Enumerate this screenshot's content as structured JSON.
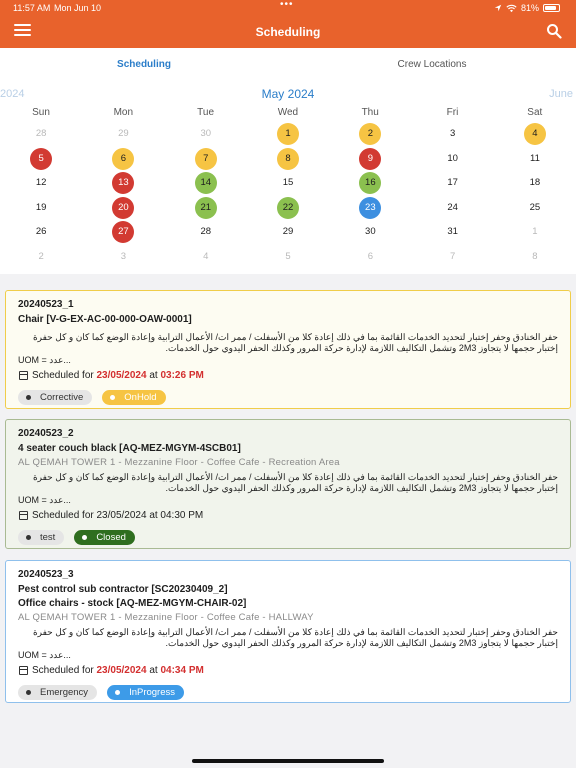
{
  "status_bar": {
    "time": "11:57 AM",
    "date": "Mon Jun 10",
    "dots": "•••",
    "battery_text": "81%",
    "battery_level": 0.81
  },
  "app_bar": {
    "title": "Scheduling"
  },
  "tabs": [
    {
      "label": "Scheduling",
      "active": true
    },
    {
      "label": "Crew Locations",
      "active": false
    }
  ],
  "calendar": {
    "prev_label": "2024",
    "month_label": "May 2024",
    "next_label": "June",
    "weekdays": [
      "Sun",
      "Mon",
      "Tue",
      "Wed",
      "Thu",
      "Fri",
      "Sat"
    ],
    "weeks": [
      [
        {
          "d": "28",
          "m": true
        },
        {
          "d": "29",
          "m": true
        },
        {
          "d": "30",
          "m": true
        },
        {
          "d": "1",
          "c": "yellow"
        },
        {
          "d": "2",
          "c": "yellow"
        },
        {
          "d": "3"
        },
        {
          "d": "4",
          "c": "yellow"
        }
      ],
      [
        {
          "d": "5",
          "c": "red"
        },
        {
          "d": "6",
          "c": "yellow"
        },
        {
          "d": "7",
          "c": "yellow"
        },
        {
          "d": "8",
          "c": "yellow"
        },
        {
          "d": "9",
          "c": "red"
        },
        {
          "d": "10"
        },
        {
          "d": "11"
        }
      ],
      [
        {
          "d": "12"
        },
        {
          "d": "13",
          "c": "red"
        },
        {
          "d": "14",
          "c": "green"
        },
        {
          "d": "15"
        },
        {
          "d": "16",
          "c": "green"
        },
        {
          "d": "17"
        },
        {
          "d": "18"
        }
      ],
      [
        {
          "d": "19"
        },
        {
          "d": "20",
          "c": "red"
        },
        {
          "d": "21",
          "c": "green"
        },
        {
          "d": "22",
          "c": "green"
        },
        {
          "d": "23",
          "c": "blue"
        },
        {
          "d": "24"
        },
        {
          "d": "25"
        }
      ],
      [
        {
          "d": "26"
        },
        {
          "d": "27",
          "c": "red"
        },
        {
          "d": "28"
        },
        {
          "d": "29"
        },
        {
          "d": "30"
        },
        {
          "d": "31"
        },
        {
          "d": "1",
          "m": true
        }
      ],
      [
        {
          "d": "2",
          "m": true
        },
        {
          "d": "3",
          "m": true
        },
        {
          "d": "4",
          "m": true
        },
        {
          "d": "5",
          "m": true
        },
        {
          "d": "6",
          "m": true
        },
        {
          "d": "7",
          "m": true
        },
        {
          "d": "8",
          "m": true
        }
      ]
    ]
  },
  "colors": {
    "brand": "#e8622c",
    "accent_blue": "#2a7dc9",
    "yellow": "#f6c443",
    "red": "#d23a32",
    "green": "#8bc04f",
    "blue": "#3d8fe0",
    "overdue_red": "#d32f2f"
  },
  "cards": [
    {
      "code": "20240523_1",
      "asset": "Chair [V-G-EX-AC-00-000-OAW-0001]",
      "description_line1": "حفر الخنادق وحفر إختبار لتحديد الخدمات القائمة بما في ذلك إعادة كلا من الأسفلت / ممر ات/ الأعمال الترابية وإعادة الوضع كما كان و كل حفرة",
      "description_line2": "إختبار حجمها لا يتجاوز 2M3 وتشمل التكاليف اللازمة لإدارة حركة المرور وكذلك  الحفر اليدوي حول الخدمات.",
      "uom": "UOM = عدد...",
      "scheduled_prefix": "Scheduled for",
      "scheduled_date": "23/05/2024",
      "scheduled_at": "at",
      "scheduled_time": "03:26 PM",
      "type_chip": "Corrective",
      "status_chip": "OnHold"
    },
    {
      "code": "20240523_2",
      "asset": "4 seater couch black [AQ-MEZ-MGYM-4SCB01]",
      "location": "AL QEMAH TOWER 1 - Mezzanine Floor - Coffee Cafe - Recreation Area",
      "description_line1": "حفر الخنادق وحفر إختبار لتحديد الخدمات القائمة بما في ذلك إعادة كلا من الأسفلت / ممر ات/ الأعمال الترابية وإعادة الوضع كما كان و كل حفرة",
      "description_line2": "إختبار حجمها لا يتجاوز 2M3 وتشمل التكاليف اللازمة لإدارة حركة المرور وكذلك  الحفر اليدوي حول الخدمات.",
      "uom": "UOM = عدد...",
      "scheduled_text": "Scheduled for 23/05/2024 at 04:30 PM",
      "type_chip": "test",
      "status_chip": "Closed"
    },
    {
      "code": "20240523_3",
      "contractor": "Pest control sub contractor [SC20230409_2]",
      "asset": "Office chairs - stock [AQ-MEZ-MGYM-CHAIR-02]",
      "location": "AL QEMAH TOWER 1 - Mezzanine Floor - Coffee Cafe - HALLWAY",
      "description_line1": "حفر الخنادق وحفر إختبار لتحديد الخدمات القائمة بما في ذلك إعادة كلا من الأسفلت / ممر ات/ الأعمال الترابية وإعادة الوضع كما كان و كل حفرة",
      "description_line2": "إختبار حجمها لا يتجاوز 2M3 وتشمل التكاليف اللازمة لإدارة حركة المرور وكذلك  الحفر اليدوي حول الخدمات.",
      "uom": "UOM = عدد...",
      "scheduled_prefix": "Scheduled for",
      "scheduled_date": "23/05/2024",
      "scheduled_at": "at",
      "scheduled_time": "04:34 PM",
      "type_chip": "Emergency",
      "status_chip": "InProgress"
    }
  ]
}
